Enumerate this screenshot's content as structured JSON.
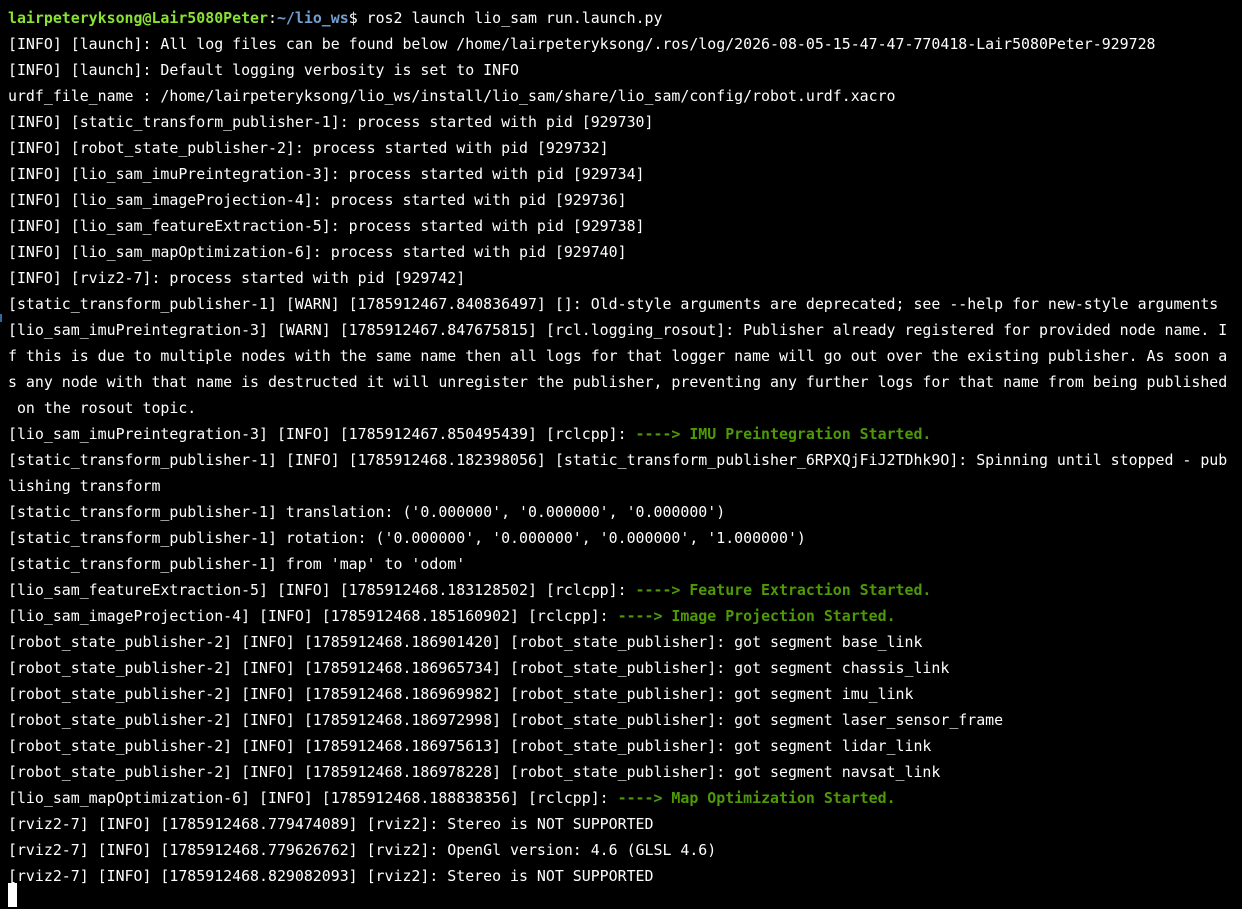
{
  "prompt": {
    "user_host": "lairpeteryksong@Lair5080Peter",
    "colon": ":",
    "cwd": "~/lio_ws",
    "symbol": "$ ",
    "command": "ros2 launch lio_sam run.launch.py"
  },
  "lines": [
    "[INFO] [launch]: All log files can be found below /home/lairpeteryksong/.ros/log/2026-08-05-15-47-47-770418-Lair5080Peter-929728",
    "[INFO] [launch]: Default logging verbosity is set to INFO",
    "urdf_file_name : /home/lairpeteryksong/lio_ws/install/lio_sam/share/lio_sam/config/robot.urdf.xacro",
    "[INFO] [static_transform_publisher-1]: process started with pid [929730]",
    "[INFO] [robot_state_publisher-2]: process started with pid [929732]",
    "[INFO] [lio_sam_imuPreintegration-3]: process started with pid [929734]",
    "[INFO] [lio_sam_imageProjection-4]: process started with pid [929736]",
    "[INFO] [lio_sam_featureExtraction-5]: process started with pid [929738]",
    "[INFO] [lio_sam_mapOptimization-6]: process started with pid [929740]",
    "[INFO] [rviz2-7]: process started with pid [929742]",
    "[static_transform_publisher-1] [WARN] [1785912467.840836497] []: Old-style arguments are deprecated; see --help for new-style arguments",
    "[lio_sam_imuPreintegration-3] [WARN] [1785912467.847675815] [rcl.logging_rosout]: Publisher already registered for provided node name. I",
    "f this is due to multiple nodes with the same name then all logs for that logger name will go out over the existing publisher. As soon a",
    "s any node with that name is destructed it will unregister the publisher, preventing any further logs for that name from being published",
    " on the rosout topic.",
    "[lio_sam_imuPreintegration-3] [INFO] [1785912467.850495439] [rclcpp]: ",
    "[static_transform_publisher-1] [INFO] [1785912468.182398056] [static_transform_publisher_6RPXQjFiJ2TDhk9O]: Spinning until stopped - pub",
    "lishing transform",
    "[static_transform_publisher-1] translation: ('0.000000', '0.000000', '0.000000')",
    "[static_transform_publisher-1] rotation: ('0.000000', '0.000000', '0.000000', '1.000000')",
    "[static_transform_publisher-1] from 'map' to 'odom'",
    "[lio_sam_featureExtraction-5] [INFO] [1785912468.183128502] [rclcpp]: ",
    "[lio_sam_imageProjection-4] [INFO] [1785912468.185160902] [rclcpp]: ",
    "[robot_state_publisher-2] [INFO] [1785912468.186901420] [robot_state_publisher]: got segment base_link",
    "[robot_state_publisher-2] [INFO] [1785912468.186965734] [robot_state_publisher]: got segment chassis_link",
    "[robot_state_publisher-2] [INFO] [1785912468.186969982] [robot_state_publisher]: got segment imu_link",
    "[robot_state_publisher-2] [INFO] [1785912468.186972998] [robot_state_publisher]: got segment laser_sensor_frame",
    "[robot_state_publisher-2] [INFO] [1785912468.186975613] [robot_state_publisher]: got segment lidar_link",
    "[robot_state_publisher-2] [INFO] [1785912468.186978228] [robot_state_publisher]: got segment navsat_link",
    "[lio_sam_mapOptimization-6] [INFO] [1785912468.188838356] [rclcpp]: ",
    "[rviz2-7] [INFO] [1785912468.779474089] [rviz2]: Stereo is NOT SUPPORTED",
    "[rviz2-7] [INFO] [1785912468.779626762] [rviz2]: OpenGl version: 4.6 (GLSL 4.6)",
    "[rviz2-7] [INFO] [1785912468.829082093] [rviz2]: Stereo is NOT SUPPORTED"
  ],
  "highlights": {
    "imu": "----> IMU Preintegration Started.",
    "feature": "----> Feature Extraction Started.",
    "image": "----> Image Projection Started.",
    "map": "----> Map Optimization Started."
  },
  "colors": {
    "background": "#000000",
    "text": "#ffffff",
    "prompt_user": "#8ae234",
    "prompt_path": "#729fcf",
    "highlight": "#4e9a06"
  }
}
